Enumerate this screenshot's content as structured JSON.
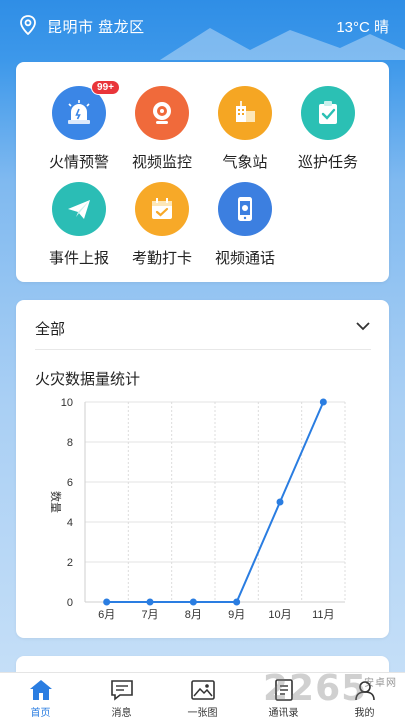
{
  "header": {
    "location": "昆明市 盘龙区",
    "weather": "13°C 晴"
  },
  "menu": {
    "items": [
      {
        "label": "火情预警",
        "icon": "siren-icon",
        "badge": "99+",
        "color": "#3b86e6"
      },
      {
        "label": "视频监控",
        "icon": "webcam-icon",
        "color": "#f06a3b"
      },
      {
        "label": "气象站",
        "icon": "weather-station-icon",
        "color": "#f5a623"
      },
      {
        "label": "巡护任务",
        "icon": "task-clipboard-icon",
        "color": "#2bc0b4"
      },
      {
        "label": "事件上报",
        "icon": "paper-plane-icon",
        "color": "#2bbdb5"
      },
      {
        "label": "考勤打卡",
        "icon": "calendar-check-icon",
        "color": "#f7a928"
      },
      {
        "label": "视频通话",
        "icon": "video-phone-icon",
        "color": "#3c7fe0"
      }
    ]
  },
  "filter": {
    "selected": "全部"
  },
  "chart_title": "火灾数据量统计",
  "chart_data": {
    "type": "line",
    "title": "火灾数据量统计",
    "xlabel": "",
    "ylabel": "数量",
    "categories": [
      "6月",
      "7月",
      "8月",
      "9月",
      "10月",
      "11月"
    ],
    "values": [
      0,
      0,
      0,
      0,
      5,
      10
    ],
    "ylim": [
      0,
      10
    ],
    "yticks": [
      0,
      2,
      4,
      6,
      8,
      10
    ],
    "grid": true,
    "color": "#2a7de1"
  },
  "tabs": [
    {
      "label": "首页",
      "icon": "home-icon",
      "active": true
    },
    {
      "label": "消息",
      "icon": "message-icon"
    },
    {
      "label": "一张图",
      "icon": "map-image-icon"
    },
    {
      "label": "通讯录",
      "icon": "contacts-icon"
    },
    {
      "label": "我的",
      "icon": "profile-icon"
    }
  ],
  "watermark": {
    "main": "2265",
    "sub": "安卓网"
  },
  "colors": {
    "accent": "#2a7de1",
    "header_bg": "#2f8ee6"
  }
}
